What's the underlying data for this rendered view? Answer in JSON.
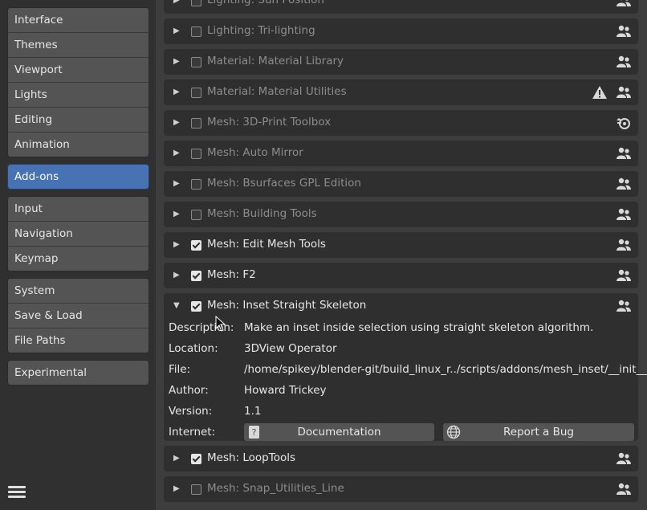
{
  "sidebar": {
    "groups": [
      [
        "Interface",
        "Themes",
        "Viewport",
        "Lights",
        "Editing",
        "Animation"
      ],
      [
        "Add-ons"
      ],
      [
        "Input",
        "Navigation",
        "Keymap"
      ],
      [
        "System",
        "Save & Load",
        "File Paths"
      ],
      [
        "Experimental"
      ]
    ],
    "active": "Add-ons",
    "menu_icon": "hamburger-menu-icon"
  },
  "addons": [
    {
      "name": "Lighting: Sun Position",
      "enabled": false,
      "expanded": false,
      "icon": "community-icon"
    },
    {
      "name": "Lighting: Tri-lighting",
      "enabled": false,
      "expanded": false,
      "icon": "community-icon"
    },
    {
      "name": "Material: Material Library",
      "enabled": false,
      "expanded": false,
      "icon": "community-icon"
    },
    {
      "name": "Material: Material Utilities",
      "enabled": false,
      "expanded": false,
      "icon": "community-icon",
      "warning": true
    },
    {
      "name": "Mesh: 3D-Print Toolbox",
      "enabled": false,
      "expanded": false,
      "icon": "blender-icon"
    },
    {
      "name": "Mesh: Auto Mirror",
      "enabled": false,
      "expanded": false,
      "icon": "community-icon"
    },
    {
      "name": "Mesh: Bsurfaces GPL Edition",
      "enabled": false,
      "expanded": false,
      "icon": "community-icon"
    },
    {
      "name": "Mesh: Building Tools",
      "enabled": false,
      "expanded": false,
      "icon": "community-icon"
    },
    {
      "name": "Mesh: Edit Mesh Tools",
      "enabled": true,
      "expanded": false,
      "icon": "community-icon"
    },
    {
      "name": "Mesh: F2",
      "enabled": true,
      "expanded": false,
      "icon": "community-icon"
    },
    {
      "name": "Mesh: Inset Straight Skeleton",
      "enabled": true,
      "expanded": true,
      "icon": "community-icon"
    },
    {
      "name": "Mesh: LoopTools",
      "enabled": true,
      "expanded": false,
      "icon": "community-icon"
    },
    {
      "name": "Mesh: Snap_Utilities_Line",
      "enabled": false,
      "expanded": false,
      "icon": "community-icon"
    }
  ],
  "details": {
    "description_label": "Description:",
    "description": "Make an inset inside selection using straight skeleton algorithm.",
    "location_label": "Location:",
    "location": "3DView Operator",
    "file_label": "File:",
    "file": "/home/spikey/blender-git/build_linux_r../scripts/addons/mesh_inset/__init__.py",
    "author_label": "Author:",
    "author": "Howard Trickey",
    "version_label": "Version:",
    "version": "1.1",
    "internet_label": "Internet:",
    "documentation_button": "Documentation",
    "report_bug_button": "Report a Bug"
  }
}
